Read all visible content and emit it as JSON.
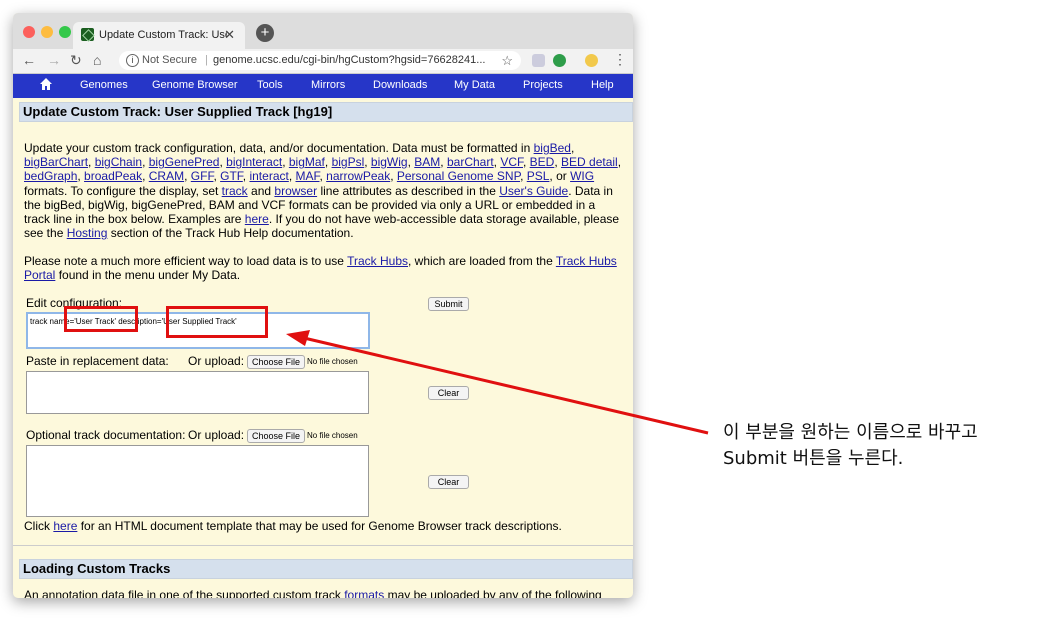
{
  "browser": {
    "tab_title": "Update Custom Track: User Su",
    "new_tab": "+",
    "not_secure": "Not Secure",
    "url": "genome.ucsc.edu/cgi-bin/hgCustom?hgsid=76628241..."
  },
  "menu": {
    "items": [
      "Genomes",
      "Genome Browser",
      "Tools",
      "Mirrors",
      "Downloads",
      "My Data",
      "Projects",
      "Help"
    ]
  },
  "page": {
    "header": "Update Custom Track: User Supplied Track [hg19]",
    "p1_start": "Update your custom track configuration, data, and/or documentation. Data must be formatted in ",
    "formats": [
      "bigBed",
      "bigBarChart",
      "bigChain",
      "bigGenePred",
      "bigInteract",
      "bigMaf",
      "bigPsl",
      "bigWig",
      "BAM",
      "barChart",
      "VCF",
      "BED",
      "BED detail",
      "bedGraph",
      "broadPeak",
      "CRAM",
      "GFF",
      "GTF",
      "interact",
      "MAF",
      "narrowPeak",
      "Personal Genome SNP",
      "PSL",
      "WIG"
    ],
    "or": "or",
    "p1_mid": "formats. To configure the display, set",
    "track_link": "track",
    "and": "and",
    "browser_link": "browser",
    "p1_mid2": "line attributes as described in the",
    "users_guide": "User's Guide",
    "p1_mid3": ". Data in the bigBed, bigWig, bigGenePred, BAM and VCF formats can be provided via only a URL or embedded in a track line in the box below. Examples are",
    "here_link": "here",
    "p1_mid4": ". If you do not have web-accessible data storage available, please see the",
    "hosting_link": "Hosting",
    "p1_end": "section of the Track Hub Help documentation.",
    "p2_start": "Please note a much more efficient way to load data is to use",
    "track_hubs_link": "Track Hubs",
    "p2_mid": ", which are loaded from the",
    "track_hubs_portal_link": "Track Hubs Portal",
    "p2_end": "found in the menu under My Data.",
    "edit_config_label": "Edit configuration:",
    "submit": "Submit",
    "config_prefix": "track na",
    "config_name": "me='User Track'",
    "config_mid": " description",
    "config_desc": "='User Supplied Track'",
    "paste_label": "Paste in replacement data:",
    "or_upload": "Or upload:",
    "choose_file": "Choose File",
    "no_file": "No file chosen",
    "clear": "Clear",
    "doc_label": "Optional track documentation:",
    "click": "Click",
    "here_doc_link": "here",
    "doc_template": "for an HTML document template that may be used for Genome Browser track descriptions.",
    "loading_header": "Loading Custom Tracks",
    "loading_text_start": "An annotation data file in one of the supported custom track",
    "loading_formats_link": "formats",
    "loading_text_end": "may be uploaded by any of the following"
  },
  "annotation": {
    "line1": "이 부분을 원하는 이름으로 바꾸고",
    "line2": "Submit 버튼을 누른다."
  },
  "colors": {
    "menu_bar": "#2636c8",
    "page_bg": "#fdf9dc",
    "highlight_box": "#e01010"
  }
}
